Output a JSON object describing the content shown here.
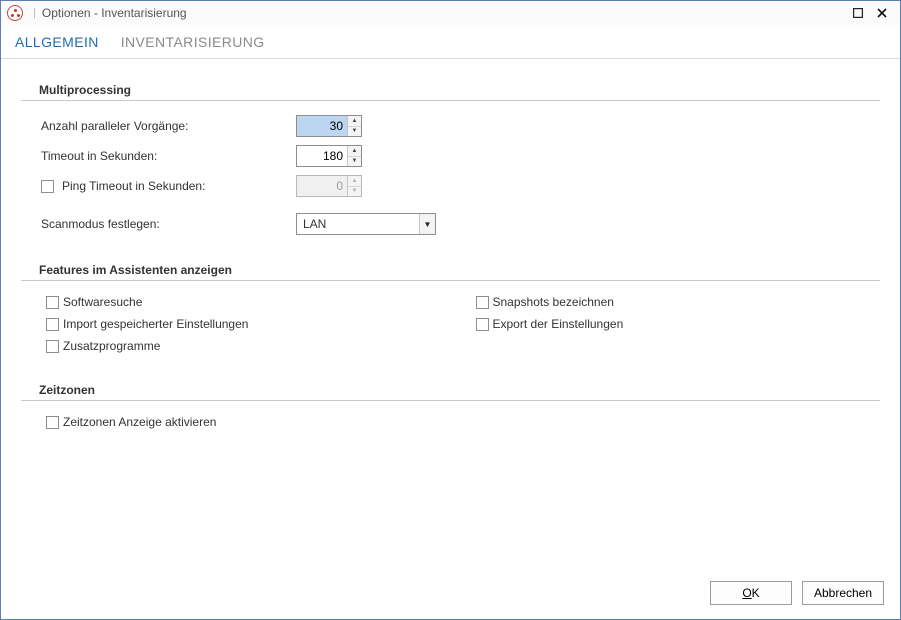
{
  "window": {
    "title": "Optionen - Inventarisierung"
  },
  "tabs": {
    "allgemein": "ALLGEMEIN",
    "inventar": "INVENTARISIERUNG"
  },
  "sections": {
    "multiprocessing": "Multiprocessing",
    "features": "Features im Assistenten anzeigen",
    "zeitzonen": "Zeitzonen"
  },
  "multi": {
    "parallelLabel": "Anzahl paralleler Vorgänge:",
    "parallelValue": "30",
    "timeoutLabel": "Timeout in Sekunden:",
    "timeoutValue": "180",
    "pingLabel": "Ping Timeout in Sekunden:",
    "pingValue": "0",
    "scanLabel": "Scanmodus festlegen:",
    "scanValue": "LAN"
  },
  "features": {
    "softwaresuche": "Softwaresuche",
    "import": "Import gespeicherter Einstellungen",
    "zusatz": "Zusatzprogramme",
    "snapshots": "Snapshots bezeichnen",
    "export": "Export der Einstellungen"
  },
  "zeitzonen": {
    "aktivieren": "Zeitzonen Anzeige aktivieren"
  },
  "buttons": {
    "ok": "OK",
    "cancel": "Abbrechen"
  }
}
